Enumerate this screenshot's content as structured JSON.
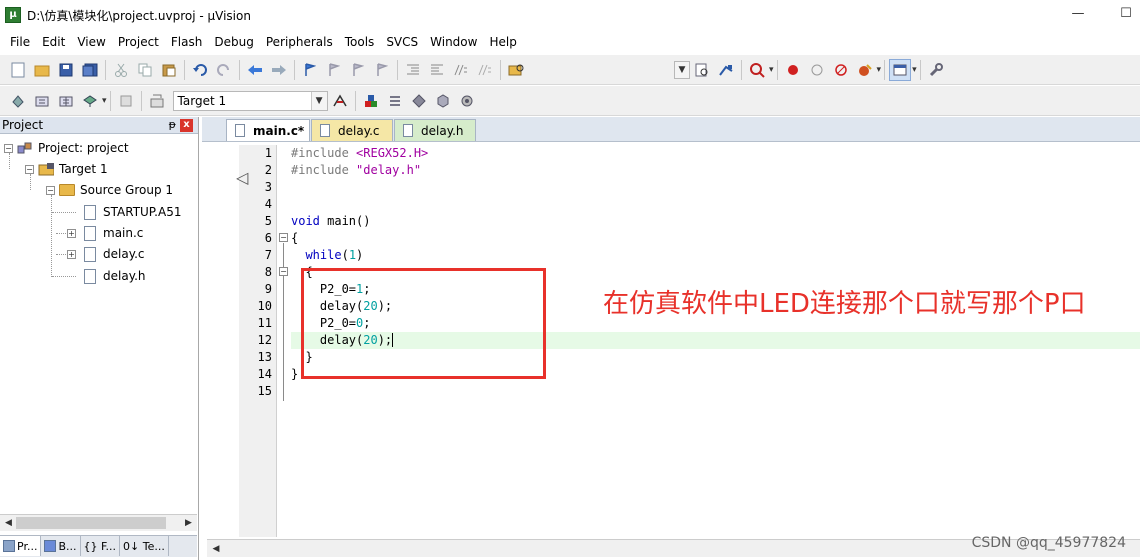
{
  "window": {
    "title": "D:\\仿真\\模块化\\project.uvproj - µVision",
    "minimize_glyph": "—",
    "maximize_glyph": "☐",
    "app_icon_glyph": "µ"
  },
  "menu": [
    "File",
    "Edit",
    "View",
    "Project",
    "Flash",
    "Debug",
    "Peripherals",
    "Tools",
    "SVCS",
    "Window",
    "Help"
  ],
  "toolbar2": {
    "target_label": "Target 1",
    "dropdown_glyph": "▼"
  },
  "project_panel": {
    "title": "Project",
    "pin_glyph": "ᵽ",
    "close_glyph": "x",
    "tree": {
      "root": "Project: project",
      "target": "Target 1",
      "group": "Source Group 1",
      "files": [
        "STARTUP.A51",
        "main.c",
        "delay.c",
        "delay.h"
      ]
    },
    "expand_minus": "−",
    "expand_plus": "+",
    "scroll_left": "◀",
    "scroll_right": "▶",
    "tabs": [
      "Pr...",
      "B...",
      "{} F...",
      "0↓ Te..."
    ]
  },
  "editor": {
    "tabs": [
      "main.c*",
      "delay.c",
      "delay.h"
    ],
    "line_numbers": [
      "1",
      "2",
      "3",
      "4",
      "5",
      "6",
      "7",
      "8",
      "9",
      "10",
      "11",
      "12",
      "13",
      "14",
      "15"
    ],
    "code": {
      "l1_pp": "#include ",
      "l1_hdr": "<REGX52.H>",
      "l2_pp": "#include ",
      "l2_hdr": "\"delay.h\"",
      "l5_kw": "void",
      "l5_rest": " main()",
      "l6": "{",
      "l7_kw": "  while",
      "l7_open": "(",
      "l7_num": "1",
      "l7_close": ")",
      "l8": "  {",
      "l9_a": "    P2_0=",
      "l9_num": "1",
      "l9_b": ";",
      "l10_a": "    delay(",
      "l10_num": "20",
      "l10_b": ");",
      "l11_a": "    P2_0=",
      "l11_num": "0",
      "l11_b": ";",
      "l12_a": "    delay(",
      "l12_num": "20",
      "l12_b": ");",
      "l13": "  }",
      "l14": "}"
    },
    "scroll_left": "◀"
  },
  "annotation": {
    "text": "在仿真软件中LED连接那个口就写那个P口",
    "color": "#e8312a"
  },
  "watermark": "CSDN @qq_45977824"
}
